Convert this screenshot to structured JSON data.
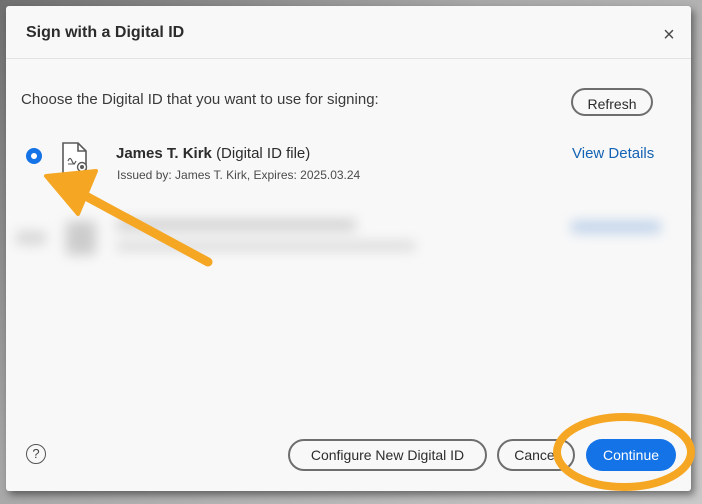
{
  "dialog": {
    "title": "Sign with a Digital ID",
    "close_label": "×",
    "prompt": "Choose the Digital ID that you want to use for signing:",
    "refresh_label": "Refresh"
  },
  "digital_id": {
    "selected": true,
    "name": "James T. Kirk",
    "type": "(Digital ID file)",
    "issued": "Issued by: James T. Kirk, Expires: 2025.03.24",
    "view_details_label": "View Details"
  },
  "footer": {
    "help_label": "?",
    "configure_label": "Configure New Digital ID",
    "cancel_label": "Cancel",
    "continue_label": "Continue"
  },
  "colors": {
    "accent": "#1473e6",
    "link": "#1463b4",
    "annotation": "#f5a623"
  },
  "icons": {
    "cert": "certificate-file-icon",
    "close": "close-icon",
    "help": "help-icon"
  }
}
